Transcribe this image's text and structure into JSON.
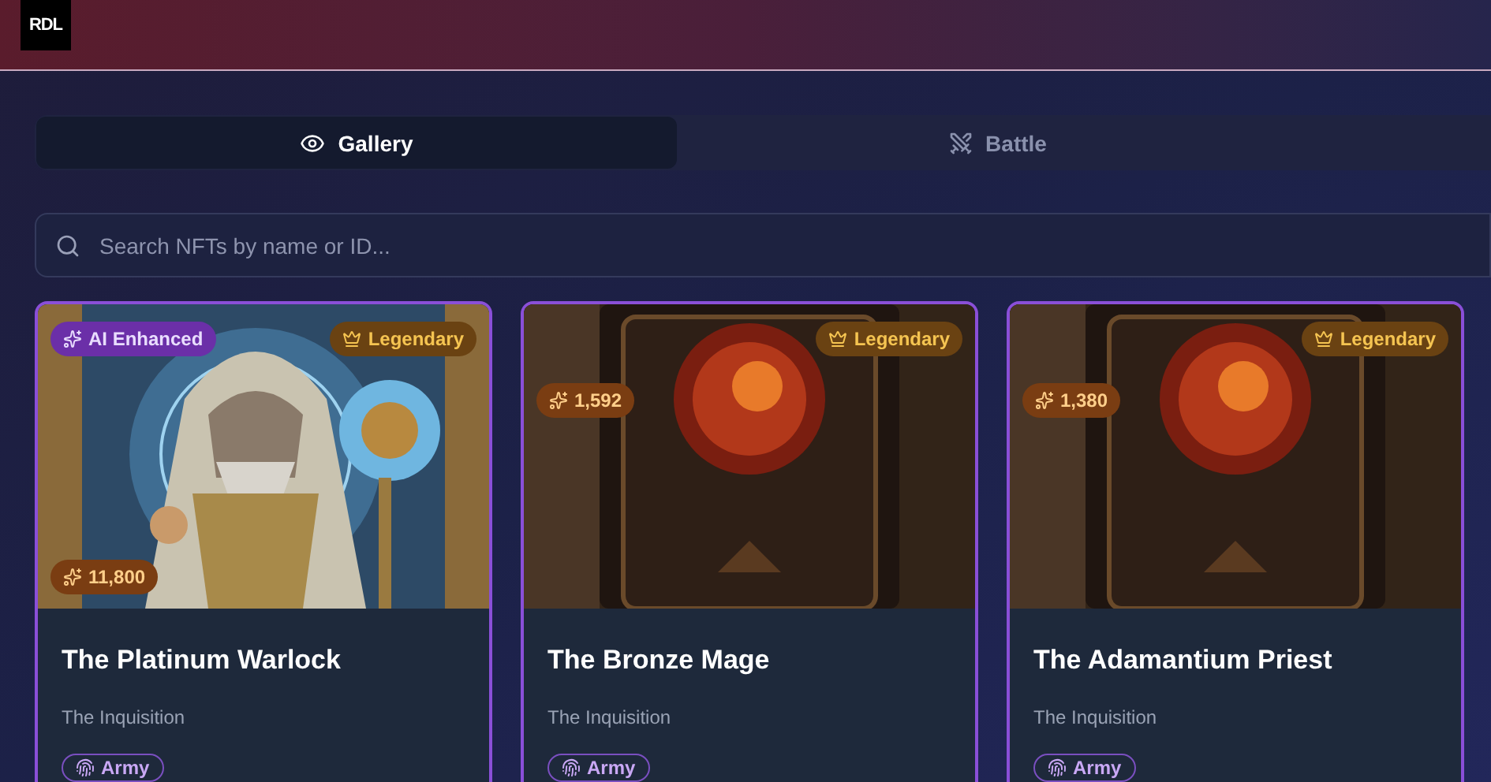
{
  "header": {
    "logo": "RDL"
  },
  "tabs": [
    {
      "label": "Gallery",
      "selected": true
    },
    {
      "label": "Battle",
      "selected": false
    }
  ],
  "search": {
    "placeholder": "Search NFTs by name or ID..."
  },
  "cards": [
    {
      "badge": "AI Enhanced",
      "rarity": "Legendary",
      "power": "11,800",
      "title": "The Platinum Warlock",
      "collection": "The Inquisition",
      "tag": "Army"
    },
    {
      "rarity": "Legendary",
      "power": "1,592",
      "title": "The Bronze Mage",
      "collection": "The Inquisition",
      "tag": "Army"
    },
    {
      "rarity": "Legendary",
      "power": "1,380",
      "title": "The Adamantium Priest",
      "collection": "The Inquisition",
      "tag": "Army"
    }
  ]
}
